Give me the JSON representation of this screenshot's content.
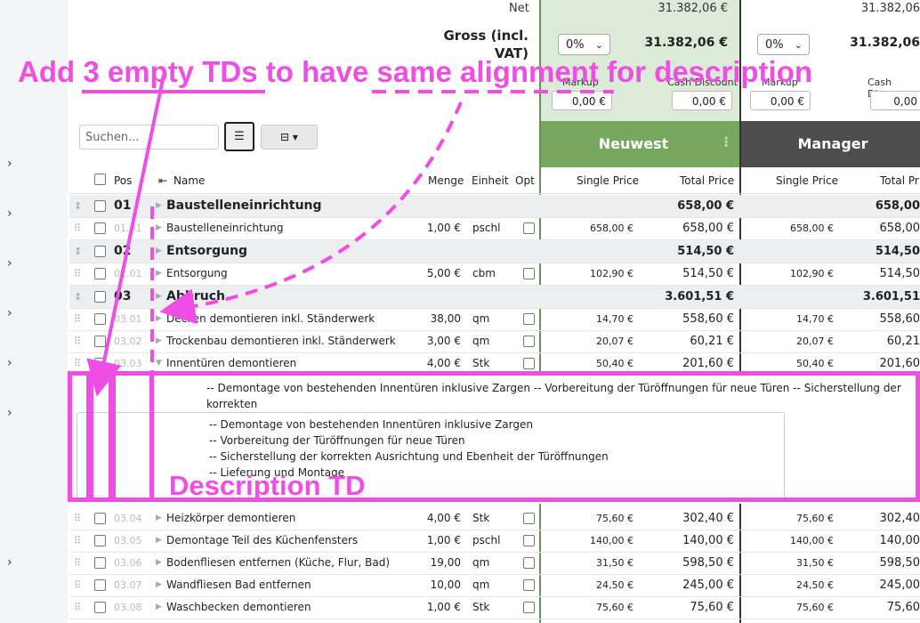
{
  "sidebar": {
    "chevron_glyph": "›"
  },
  "summary": {
    "net_label": "Net",
    "net_value_1": "31.382,06 €",
    "net_value_2": "31.382,06",
    "gross_label": "Gross (incl.",
    "gross_label_2": "VAT)",
    "vat_option_1": "0%",
    "vat_option_2": "0%",
    "gross_value_1": "31.382,06 €",
    "gross_value_2": "31.382,06",
    "markup_label": "Markup",
    "markup_value_1": "0,00 €",
    "markup_label_2": "Markup",
    "markup_value_2": "0,00 €",
    "cash_discount_label": "Cash Discount",
    "cash_discount_value_1": "0,00 €",
    "cash_discount_label_2": "Cash Discou",
    "cash_discount_value_2": "0,00"
  },
  "toolbar": {
    "search_placeholder": "Suchen...",
    "columns_button_label": "⊟ ▾"
  },
  "bidders": [
    {
      "name": "Neuwest",
      "color": "#78a85f"
    },
    {
      "name": "Manager",
      "color": "#4d4d4d"
    }
  ],
  "table": {
    "headers": {
      "pos": "Pos",
      "name": "Name",
      "qty": "Menge",
      "unit": "Einheit",
      "opt": "Opt",
      "single_price": "Single Price",
      "total_price": "Total Price",
      "single_price_2": "Single Price",
      "total_price_2": "Total Pr"
    },
    "rows": [
      {
        "type": "group",
        "pos": "01",
        "name": "Baustelleneinrichtung",
        "qty": "",
        "unit": "",
        "sp1": "",
        "tp1": "658,00 €",
        "sp2": "",
        "tp2": "658,00"
      },
      {
        "type": "item",
        "pos": "01.01",
        "name": "Baustelleneinrichtung",
        "qty": "1,00 €",
        "unit": "pschl",
        "sp1": "658,00 €",
        "tp1": "658,00 €",
        "sp2": "658,00 €",
        "tp2": "658,00"
      },
      {
        "type": "group",
        "pos": "02",
        "name": "Entsorgung",
        "qty": "",
        "unit": "",
        "sp1": "",
        "tp1": "514,50 €",
        "sp2": "",
        "tp2": "514,50"
      },
      {
        "type": "item",
        "pos": "02.01",
        "name": "Entsorgung",
        "qty": "5,00 €",
        "unit": "cbm",
        "sp1": "102,90 €",
        "tp1": "514,50 €",
        "sp2": "102,90 €",
        "tp2": "514,50"
      },
      {
        "type": "group",
        "pos": "03",
        "name": "Abbruch",
        "qty": "",
        "unit": "",
        "sp1": "",
        "tp1": "3.601,51 €",
        "sp2": "",
        "tp2": "3.601,51"
      },
      {
        "type": "item",
        "pos": "03.01",
        "name": "Decken demontieren inkl. Ständerwerk",
        "qty": "38,00",
        "unit": "qm",
        "sp1": "14,70 €",
        "tp1": "558,60 €",
        "sp2": "14,70 €",
        "tp2": "558,60"
      },
      {
        "type": "item",
        "pos": "03.02",
        "name": "Trockenbau demontieren inkl. Ständerwerk",
        "qty": "3,00 €",
        "unit": "qm",
        "sp1": "20,07 €",
        "tp1": "60,21 €",
        "sp2": "20,07 €",
        "tp2": "60,21"
      },
      {
        "type": "item",
        "pos": "03.03",
        "name": "Innentüren demontieren",
        "qty": "4,00 €",
        "unit": "Stk",
        "sp1": "50,40 €",
        "tp1": "201,60 €",
        "sp2": "50,40 €",
        "tp2": "201,60"
      },
      {
        "type": "item",
        "pos": "03.04",
        "name": "Heizkörper demontieren",
        "qty": "4,00 €",
        "unit": "Stk",
        "sp1": "75,60 €",
        "tp1": "302,40 €",
        "sp2": "75,60 €",
        "tp2": "302,40"
      },
      {
        "type": "item",
        "pos": "03.05",
        "name": "Demontage Teil des Küchenfensters",
        "qty": "1,00 €",
        "unit": "pschl",
        "sp1": "140,00 €",
        "tp1": "140,00 €",
        "sp2": "140,00 €",
        "tp2": "140,00"
      },
      {
        "type": "item",
        "pos": "03.06",
        "name": "Bodenfliesen entfernen (Küche, Flur, Bad)",
        "qty": "19,00",
        "unit": "qm",
        "sp1": "31,50 €",
        "tp1": "598,50 €",
        "sp2": "31,50 €",
        "tp2": "598,50"
      },
      {
        "type": "item",
        "pos": "03.07",
        "name": "Wandfliesen Bad entfernen",
        "qty": "10,00",
        "unit": "qm",
        "sp1": "24,50 €",
        "tp1": "245,00 €",
        "sp2": "24,50 €",
        "tp2": "245,00"
      },
      {
        "type": "item",
        "pos": "03.08",
        "name": "Waschbecken demontieren",
        "qty": "1,00 €",
        "unit": "Stk",
        "sp1": "75,60 €",
        "tp1": "75,60 €",
        "sp2": "75,60 €",
        "tp2": "75,60"
      }
    ]
  },
  "description": {
    "summary_line_1": "-- Demontage von bestehenden Innentüren inklusive Zargen -- Vorbereitung der Türöffnungen für neue Türen -- Sicherstellung der korrekten",
    "summary_line_2": "Ausrichtung und Ebenheit der Türöffnungen -- Lieferung und Montage",
    "textarea_lines": [
      "--  Demontage von bestehenden Innentüren inklusive Zargen",
      "--  Vorbereitung der Türöffnungen für neue Türen",
      "--  Sicherstellung der korrekten Ausrichtung und Ebenheit der Türöffnungen",
      "--  Lieferung und Montage"
    ]
  },
  "annotations": {
    "top_note": "Add 3 empty TDs to have same alignment for description",
    "description_td_label": "Description TD",
    "color": "#ee4ee3"
  }
}
